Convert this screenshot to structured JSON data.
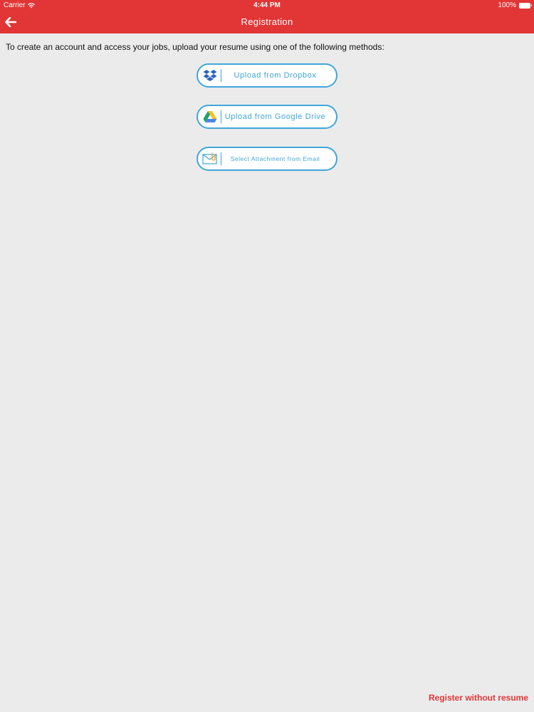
{
  "status_bar": {
    "carrier": "Carrier",
    "time": "4:44 PM",
    "battery": "100%"
  },
  "nav": {
    "title": "Registration",
    "back_icon": "arrow-left-icon"
  },
  "intro_text": "To create an account and access your jobs, upload your resume using one of the following methods:",
  "upload_options": [
    {
      "label": "Upload from Dropbox",
      "icon": "dropbox-icon"
    },
    {
      "label": "Upload from Google Drive",
      "icon": "google-drive-icon"
    },
    {
      "label": "Select Attachment from Email",
      "icon": "email-attachment-icon"
    }
  ],
  "footer": {
    "register_without_resume": "Register without resume"
  },
  "colors": {
    "brand_red": "#e23535",
    "accent_blue": "#3fa6da",
    "background": "#ebebec"
  }
}
